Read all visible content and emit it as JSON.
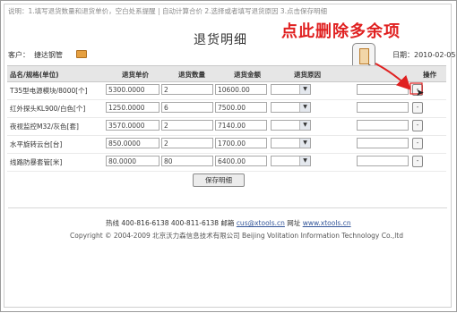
{
  "instruction": "说明：1.填写退货数量和退货单价，空白处系提醒 | 自动计算合价 2.选择或者填写退货原因 3.点击保存明细",
  "annotation": "点此删除多余项",
  "title": "退货明细",
  "customer": {
    "label": "客户：",
    "name": "捷达钢管"
  },
  "date": "日期：2010-02-05",
  "columns": {
    "name": "品名/规格(单位)",
    "price": "退货单价",
    "qty": "退货数量",
    "amount": "退货金额",
    "reason": "退货原因",
    "action": "操作"
  },
  "rows": [
    {
      "name": "T35型电源模块/8000[个]",
      "price": "5300.0000",
      "qty": "2",
      "amount": "10600.00",
      "delete": "-"
    },
    {
      "name": "红外探头KL900/白色[个]",
      "price": "1250.0000",
      "qty": "6",
      "amount": "7500.00",
      "delete": "-"
    },
    {
      "name": "夜视监控M32/灰色[套]",
      "price": "3570.0000",
      "qty": "2",
      "amount": "7140.00",
      "delete": "-"
    },
    {
      "name": "水平旋转云台[台]",
      "price": "850.0000",
      "qty": "2",
      "amount": "1700.00",
      "delete": "-"
    },
    {
      "name": "线路防暴套管[米]",
      "price": "80.0000",
      "qty": "80",
      "amount": "6400.00",
      "delete": "-"
    }
  ],
  "save_button": "保存明细",
  "footer": {
    "hotline_label": "热线 400-816-6138  400-811-6138  邮箱",
    "email": "cus@xtools.cn",
    "web_label": "网址",
    "website": "www.xtools.cn",
    "copyright": "Copyright © 2004-2009  北京沃力森信息技术有限公司    Beijing Volitation Information Technology Co.,ltd"
  },
  "colors": {
    "annotation": "#e02020",
    "header_bg": "#e6e6e6",
    "link": "#335599"
  },
  "icons": [
    "folder-icon",
    "document-icon",
    "cursor-icon",
    "dropdown-arrow-icon",
    "delete-icon"
  ]
}
